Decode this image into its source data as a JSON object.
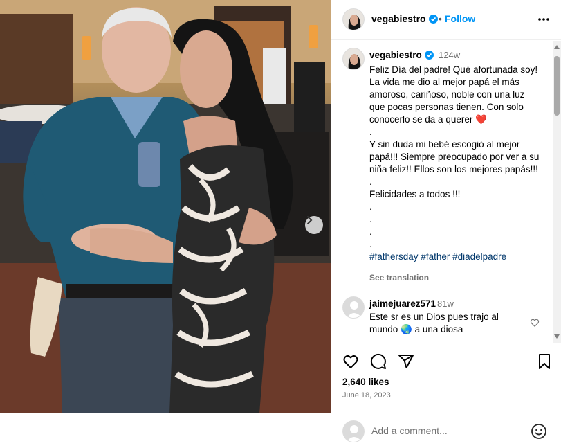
{
  "post": {
    "username": "vegabiestro",
    "follow_label": "Follow",
    "dot_separator": "•",
    "time_ago": "124w",
    "caption_lines": [
      "Feliz Día del padre! Qué afortunada soy! La vida me dio al mejor papá el más amoroso, cariñoso, noble con una luz que pocas personas tienen. Con solo conocerlo se da a querer",
      ".",
      "Y sin duda mi bebé escogió al mejor papá!!! Siempre preocupado por ver a su niña feliz!! Ellos son los mejores papás!!!",
      ".",
      "Felicidades a todos !!!",
      ".",
      ".",
      ".",
      "."
    ],
    "caption_heart": "❤️",
    "hashtags": [
      "#fathersday",
      "#father",
      "#diadelpadre"
    ],
    "see_translation": "See translation",
    "likes": "2,640 likes",
    "date": "June 18, 2023"
  },
  "comment": {
    "username": "jaimejuarez571",
    "time_ago": "81w",
    "text_before_globe": "Este sr es un Dios pues trajo al mundo",
    "globe": "🌏",
    "text_after_globe": "a una diosa"
  },
  "add_comment": {
    "placeholder": "Add a comment..."
  },
  "colors": {
    "accent": "#0095f6",
    "hashtag": "#00376b",
    "muted": "#737373",
    "verified": "#0095f6"
  },
  "icons": {
    "verified": "verified-badge-icon",
    "more": "more-options-icon",
    "next": "chevron-right-icon",
    "like": "heart-icon",
    "comment": "comment-icon",
    "share": "share-icon",
    "save": "bookmark-icon",
    "emoji": "emoji-icon"
  }
}
